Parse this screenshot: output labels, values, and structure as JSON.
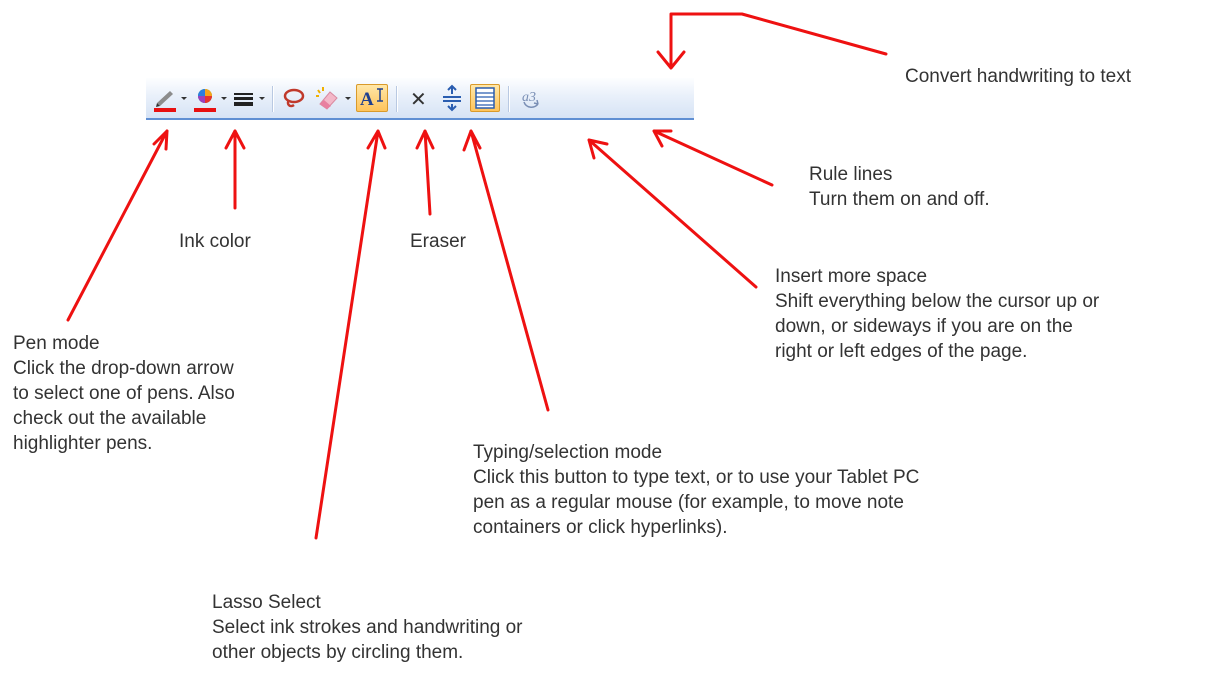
{
  "toolbar": {
    "buttons": [
      {
        "name": "pen-mode-button",
        "icon": "pen-icon"
      },
      {
        "name": "ink-color-button",
        "icon": "color-wheel-icon"
      },
      {
        "name": "line-weight-button",
        "icon": "line-weight-icon"
      },
      {
        "name": "lasso-select-button",
        "icon": "lasso-icon"
      },
      {
        "name": "eraser-button",
        "icon": "eraser-icon"
      },
      {
        "name": "typing-selection-mode-button",
        "icon": "text-cursor-icon",
        "glyph": "A",
        "active": true
      },
      {
        "name": "delete-button",
        "icon": "close-icon",
        "glyph": "✕"
      },
      {
        "name": "insert-space-button",
        "icon": "insert-space-icon"
      },
      {
        "name": "rule-lines-button",
        "icon": "rule-lines-icon",
        "active": true
      },
      {
        "name": "convert-handwriting-button",
        "icon": "convert-handwriting-icon",
        "glyph": "a3"
      }
    ]
  },
  "annotations": {
    "convert": {
      "title": "Convert handwriting to text"
    },
    "rule_lines": {
      "title": "Rule lines",
      "lines": [
        "Turn them on and off."
      ]
    },
    "ink_color": {
      "title": "Ink color"
    },
    "eraser": {
      "title": "Eraser"
    },
    "insert_space": {
      "title": "Insert more space",
      "lines": [
        "Shift everything below the cursor up or",
        "down, or sideways if you are on the",
        "right or left edges of the page."
      ]
    },
    "pen_mode": {
      "title": "Pen mode",
      "lines": [
        "Click the drop-down arrow",
        "to select one of pens. Also",
        "check out the available",
        "highlighter pens."
      ]
    },
    "typing_mode": {
      "title": "Typing/selection mode",
      "lines": [
        "Click this button to type text, or to use your Tablet PC",
        "pen as a regular mouse (for example, to move note",
        "containers or click hyperlinks)."
      ]
    },
    "lasso": {
      "title": "Lasso Select",
      "lines": [
        "Select ink strokes and handwriting or",
        "other objects by circling them."
      ]
    }
  },
  "colors": {
    "arrow": "#ee1111",
    "toolbar_accent": "#5f8fd3",
    "ink_red": "#e81010",
    "active": "#ffc45a"
  }
}
